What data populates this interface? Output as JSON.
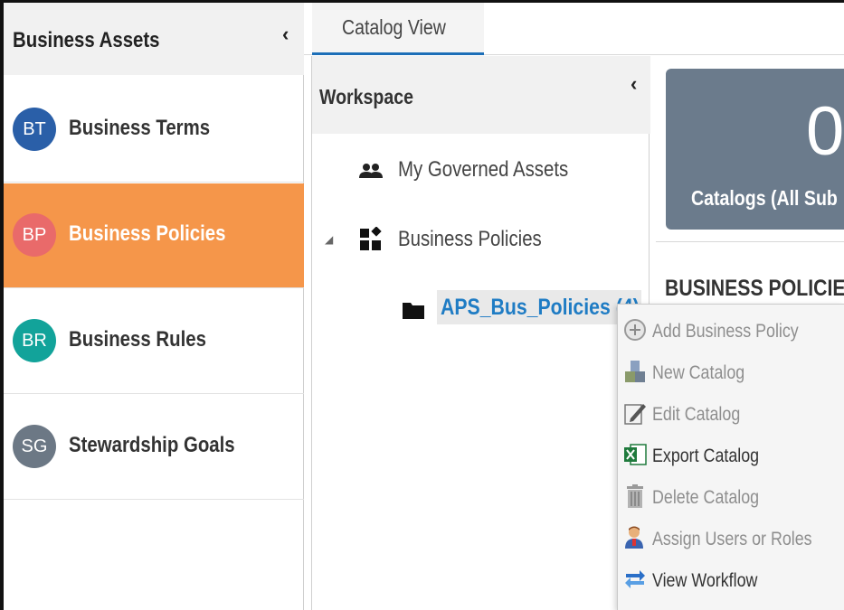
{
  "sidebar": {
    "title": "Business Assets",
    "items": [
      {
        "initials": "BT",
        "label": "Business Terms",
        "color": "#2a5fa8",
        "active": false
      },
      {
        "initials": "BP",
        "label": "Business Policies",
        "color": "#e96a6a",
        "active": true
      },
      {
        "initials": "BR",
        "label": "Business Rules",
        "color": "#12a39a",
        "active": false
      },
      {
        "initials": "SG",
        "label": "Stewardship Goals",
        "color": "#6c7885",
        "active": false
      }
    ]
  },
  "tabs": [
    {
      "label": "Catalog View",
      "active": true
    }
  ],
  "workspace": {
    "title": "Workspace",
    "tree": {
      "governed": "My Governed Assets",
      "policies": "Business Policies",
      "selected_node": "APS_Bus_Policies (4)"
    }
  },
  "content": {
    "tile_count": "0",
    "tile_label": "Catalogs (All Sub",
    "section_title": "BUSINESS POLICIES"
  },
  "context_menu": {
    "items": [
      {
        "label": "Add Business Policy",
        "enabled": false,
        "icon": "add-circle-icon"
      },
      {
        "label": "New Catalog",
        "enabled": false,
        "icon": "new-catalog-icon"
      },
      {
        "label": "Edit Catalog",
        "enabled": false,
        "icon": "edit-icon"
      },
      {
        "label": "Export Catalog",
        "enabled": true,
        "icon": "excel-export-icon"
      },
      {
        "label": "Delete Catalog",
        "enabled": false,
        "icon": "trash-icon"
      },
      {
        "label": "Assign Users or Roles",
        "enabled": false,
        "icon": "user-assign-icon"
      },
      {
        "label": "View Workflow",
        "enabled": true,
        "icon": "workflow-icon"
      }
    ]
  },
  "colors": {
    "accent": "#1d6fb8",
    "active_item": "#f5964a",
    "tile": "#6b7b8c",
    "link": "#1f7cc4"
  }
}
